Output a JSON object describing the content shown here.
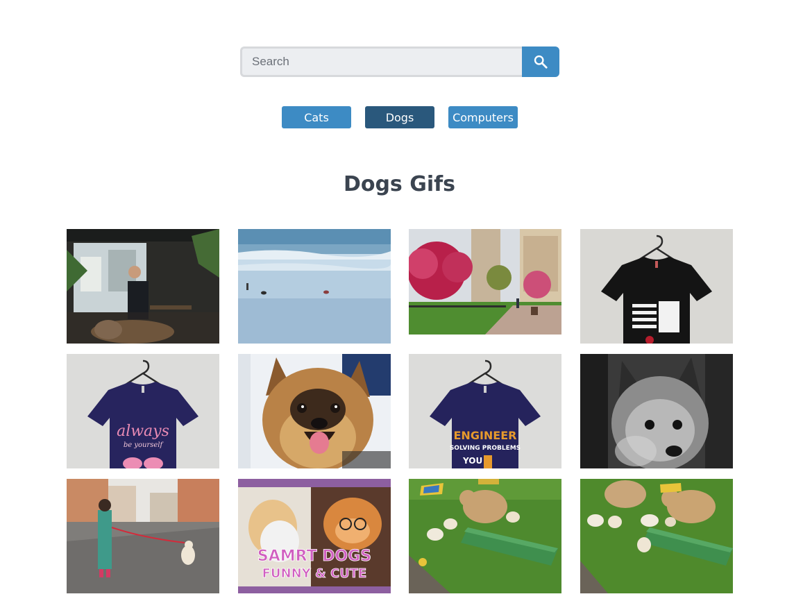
{
  "search": {
    "placeholder": "Search",
    "button_icon": "search-icon",
    "accent": "#3d8bc4"
  },
  "categories": [
    {
      "label": "Cats",
      "active": false
    },
    {
      "label": "Dogs",
      "active": true
    },
    {
      "label": "Computers",
      "active": false
    }
  ],
  "colors": {
    "button": "#3d8bc4",
    "button_active": "#2a587c",
    "heading": "#3b4450"
  },
  "heading": "Dogs Gifs",
  "gifs": [
    {
      "subject": "cafe-dogs"
    },
    {
      "subject": "beach-dogs"
    },
    {
      "subject": "park-blossoms"
    },
    {
      "subject": "black-flag-shirt"
    },
    {
      "subject": "always-be-yourself-shirt",
      "text_line1": "always",
      "text_line2": "be yourself"
    },
    {
      "subject": "smiling-dog"
    },
    {
      "subject": "engineer-shirt",
      "text_line1": "ENGINEER",
      "text_line2": "SOLVING PROBLEMS",
      "text_line3": "YOU"
    },
    {
      "subject": "bw-terrier"
    },
    {
      "subject": "girl-walking-puppy"
    },
    {
      "subject": "smart-dogs-thumbnail",
      "text_line1": "SAMRT DOGS",
      "text_line2": "FUNNY & CUTE"
    },
    {
      "subject": "golden-puppies-1"
    },
    {
      "subject": "golden-puppies-2"
    }
  ]
}
